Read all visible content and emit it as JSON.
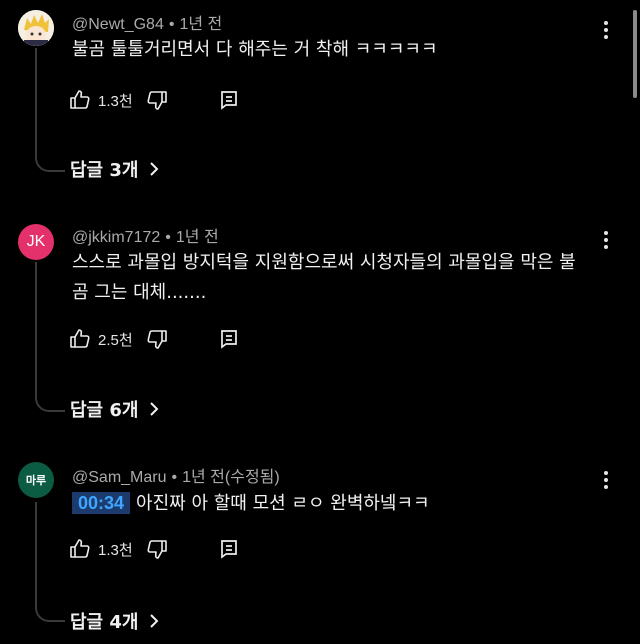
{
  "comments": [
    {
      "author": "@Newt_G84",
      "time": "1년 전",
      "edited": "",
      "timestamp": "",
      "text": "불곰 툴툴거리면서 다 해주는 거 착해 ㅋㅋㅋㅋㅋ",
      "likes": "1.3천",
      "replies": "답글 3개",
      "avatar_text": ""
    },
    {
      "author": "@jkkim7172",
      "time": "1년 전",
      "edited": "",
      "timestamp": "",
      "text": "스스로 과몰입 방지턱을 지원함으로써 시청자들의 과몰입을 막은 불곰 그는 대체.......",
      "likes": "2.5천",
      "replies": "답글 6개",
      "avatar_text": "JK"
    },
    {
      "author": "@Sam_Maru",
      "time": "1년 전",
      "edited": "(수정됨)",
      "timestamp": "00:34",
      "text": "아진짜 아 할때 모션 ㄹㅇ 완벽하넼ㅋㅋ",
      "likes": "1.3천",
      "replies": "답글 4개",
      "avatar_text": "마루"
    }
  ],
  "icons": {
    "like": "thumbs-up-icon",
    "dislike": "thumbs-down-icon",
    "reply": "comment-reply-icon",
    "more": "more-vertical-icon",
    "chevron": "chevron-right-icon"
  },
  "colors": {
    "background": "#000000",
    "timestamp_link": "#3ea6ff",
    "avatar_jk": "#e5316b",
    "avatar_maru": "#0b5c43"
  }
}
